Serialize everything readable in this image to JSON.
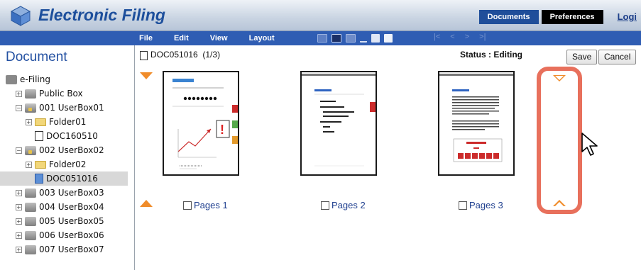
{
  "app": {
    "title": "Electronic Filing"
  },
  "topnav": {
    "documents": "Documents",
    "preferences": "Preferences",
    "logout": "Logi"
  },
  "menu": {
    "items": [
      "File",
      "Edit",
      "View",
      "Layout"
    ]
  },
  "toolbar": {
    "icons": [
      "copy-icon",
      "save-icon",
      "print-icon",
      "cut-icon",
      "copy-pages-icon",
      "paste-icon"
    ],
    "nav": [
      "|<",
      "<",
      ">",
      ">|"
    ]
  },
  "sidebar": {
    "title": "Document",
    "tree": [
      {
        "label": "e-Filing",
        "icon": "root",
        "depth": 0,
        "expander": "",
        "selected": false
      },
      {
        "label": "Public Box",
        "icon": "box",
        "depth": 1,
        "expander": "+",
        "selected": false
      },
      {
        "label": "001 UserBox01",
        "icon": "userbox",
        "depth": 1,
        "expander": "−",
        "selected": false
      },
      {
        "label": "Folder01",
        "icon": "folder",
        "depth": 2,
        "expander": "+",
        "selected": false
      },
      {
        "label": "DOC160510",
        "icon": "doc",
        "depth": 2,
        "expander": "",
        "selected": false
      },
      {
        "label": "002 UserBox02",
        "icon": "userbox",
        "depth": 1,
        "expander": "−",
        "selected": false
      },
      {
        "label": "Folder02",
        "icon": "folder",
        "depth": 2,
        "expander": "+",
        "selected": false
      },
      {
        "label": "DOC051016",
        "icon": "doc",
        "depth": 2,
        "expander": "",
        "selected": true
      },
      {
        "label": "003 UserBox03",
        "icon": "box",
        "depth": 1,
        "expander": "+",
        "selected": false
      },
      {
        "label": "004 UserBox04",
        "icon": "box",
        "depth": 1,
        "expander": "+",
        "selected": false
      },
      {
        "label": "005 UserBox05",
        "icon": "box",
        "depth": 1,
        "expander": "+",
        "selected": false
      },
      {
        "label": "006 UserBox06",
        "icon": "box",
        "depth": 1,
        "expander": "+",
        "selected": false
      },
      {
        "label": "007 UserBox07",
        "icon": "box",
        "depth": 1,
        "expander": "+",
        "selected": false
      }
    ]
  },
  "document": {
    "title": "DOC051016",
    "page_info": "(1/3)",
    "status": "Status : Editing",
    "save_label": "Save",
    "cancel_label": "Cancel",
    "pages": [
      "Pages 1",
      "Pages 2",
      "Pages 3"
    ]
  },
  "colors": {
    "accent": "#2f5db3",
    "highlight": "#e8705c",
    "arrow": "#f08c2a"
  }
}
